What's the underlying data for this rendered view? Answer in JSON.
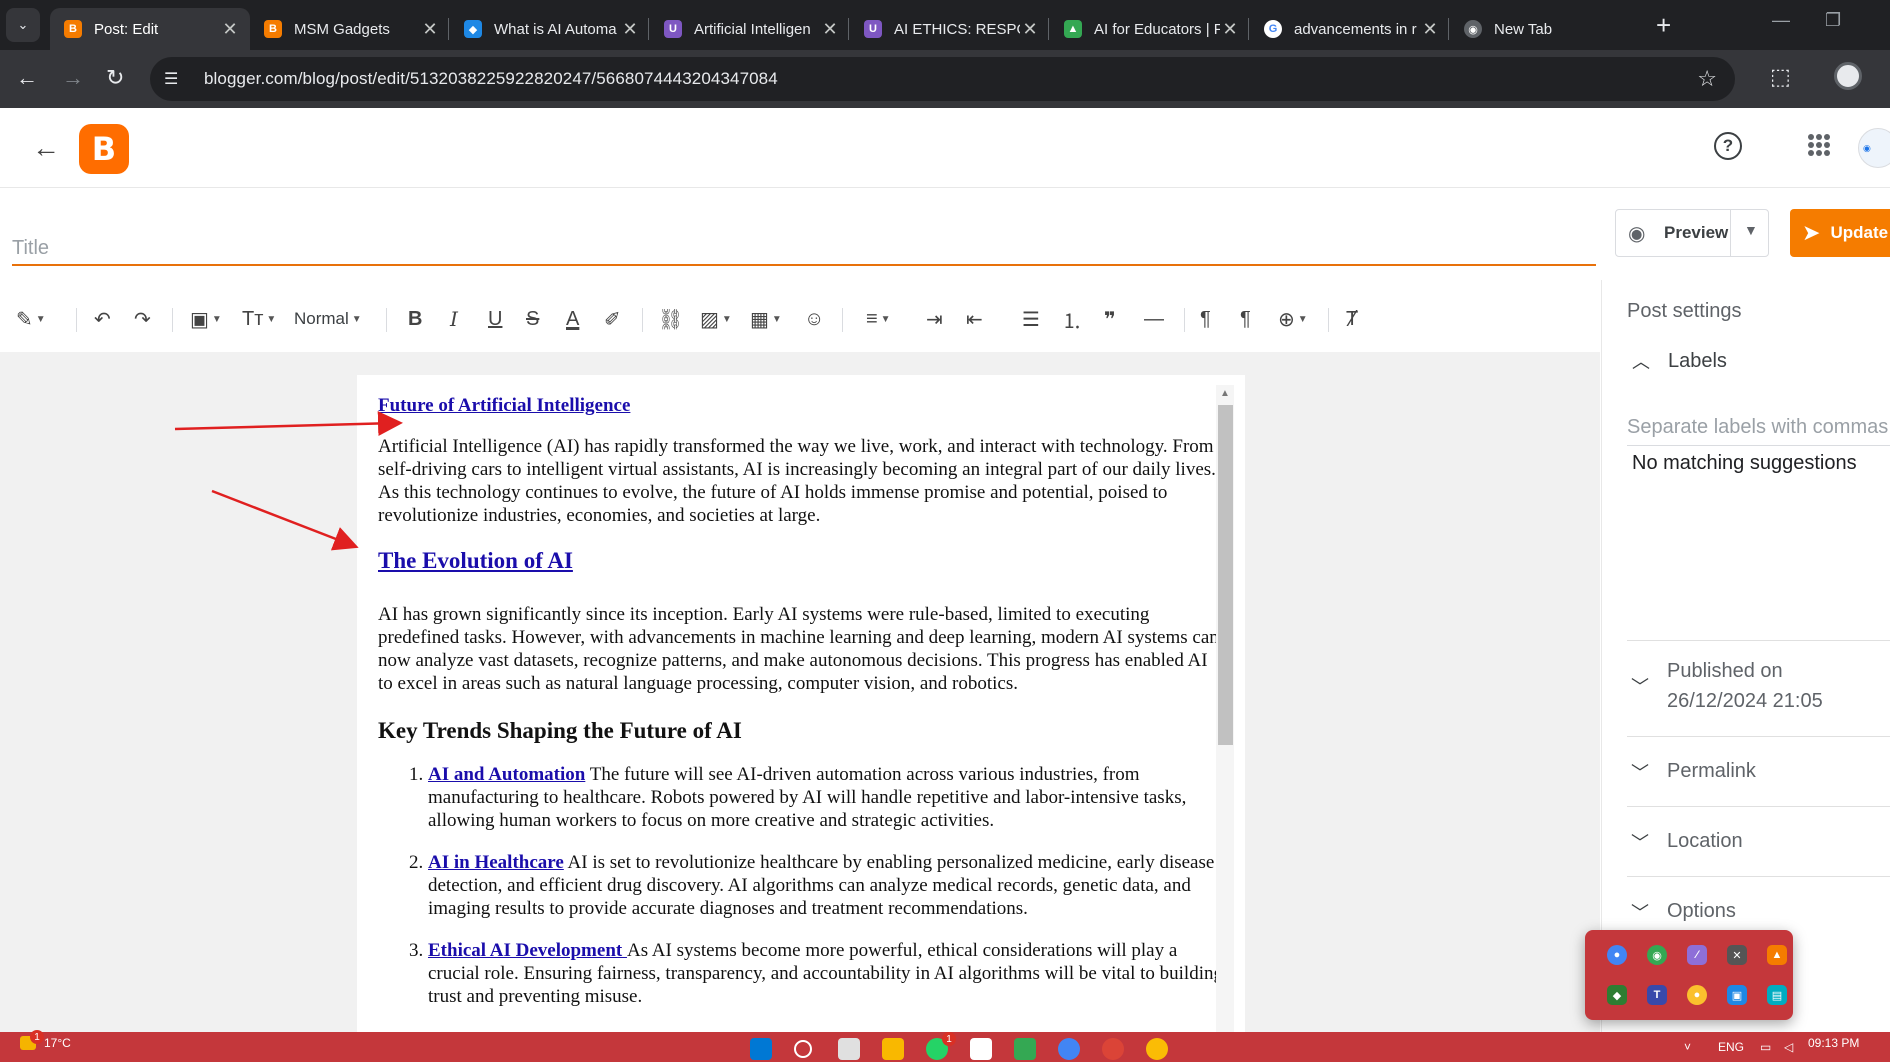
{
  "browser": {
    "tabs": [
      {
        "label": "Post: Edit",
        "color": "#f57c00",
        "glyph": "B"
      },
      {
        "label": "MSM Gadgets",
        "color": "#f57c00",
        "glyph": "B"
      },
      {
        "label": "What is AI Automa",
        "color": "#1e88e5",
        "glyph": "◆"
      },
      {
        "label": "Artificial Intelligen",
        "color": "#7e57c2",
        "glyph": "U"
      },
      {
        "label": "AI ETHICS: RESPON",
        "color": "#7e57c2",
        "glyph": "U"
      },
      {
        "label": "AI for Educators | F",
        "color": "#34a853",
        "glyph": "▲"
      },
      {
        "label": "advancements in r",
        "color": "#ffffff",
        "glyph": "G"
      },
      {
        "label": "New Tab",
        "color": "#9aa0a6",
        "glyph": "◉"
      }
    ],
    "url": "blogger.com/blog/post/edit/5132038225922820247/5668074443204347084"
  },
  "editor": {
    "title_placeholder": "Title",
    "preview_label": "Preview",
    "update_label": "Update",
    "format_label": "Normal"
  },
  "post": {
    "h1": "Future of Artificial Intelligence",
    "intro": "Artificial Intelligence (AI) has rapidly transformed the way we live, work, and interact with technology. From self-driving cars to intelligent virtual assistants, AI is increasingly becoming an integral part of our daily lives. As this technology continues to evolve, the future of AI holds immense promise and potential, poised to revolutionize industries, economies, and societies at large.",
    "h2_evolution": "The Evolution of AI",
    "evolution_text": "AI has grown significantly since its inception. Early AI systems were rule-based, limited to executing predefined tasks. However, with advancements in machine learning and deep learning, modern AI systems can now analyze vast datasets, recognize patterns, and make autonomous decisions. This progress has enabled AI to excel in areas such as natural language processing, computer vision, and robotics.",
    "h2_trends": "Key Trends Shaping the Future of AI",
    "trends": [
      {
        "title": "AI and Automation",
        "text": " The future will see AI-driven automation across various industries, from manufacturing to healthcare. Robots powered by AI will handle repetitive and labor-intensive tasks, allowing human workers to focus on more creative and strategic activities."
      },
      {
        "title": "AI in Healthcare",
        "text": " AI is set to revolutionize healthcare by enabling personalized medicine, early disease detection, and efficient drug discovery. AI algorithms can analyze medical records, genetic data, and imaging results to provide accurate diagnoses and treatment recommendations."
      },
      {
        "title": "Ethical AI Development ",
        "text": "As AI systems become more powerful, ethical considerations will play a crucial role. Ensuring fairness, transparency, and accountability in AI algorithms will be vital to building trust and preventing misuse."
      }
    ]
  },
  "settings": {
    "header": "Post settings",
    "labels": "Labels",
    "labels_placeholder": "Separate labels with commas",
    "no_suggestions": "No matching suggestions",
    "published_label": "Published on",
    "published_date": "26/12/2024 21:05",
    "permalink": "Permalink",
    "location": "Location",
    "options": "Options"
  },
  "taskbar": {
    "temperature": "17°C",
    "language": "ENG",
    "time": "09:13 PM",
    "notification_count": "1"
  }
}
